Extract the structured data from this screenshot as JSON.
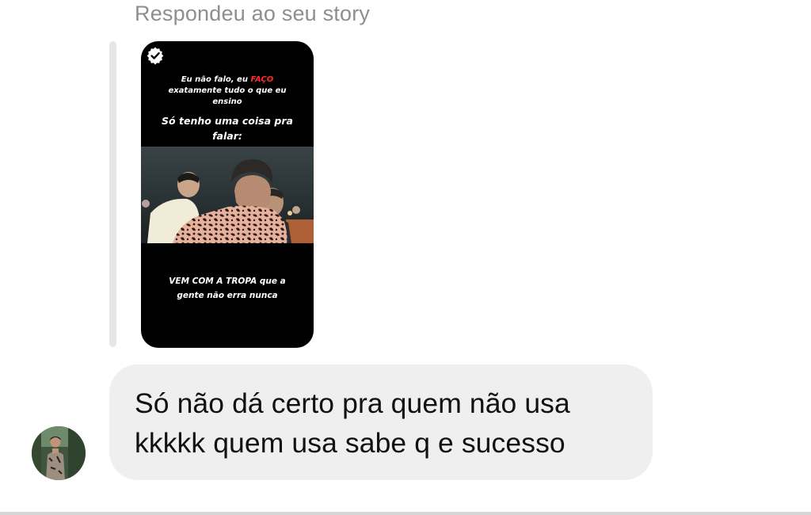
{
  "reply_context": "Respondeu ao seu story",
  "story": {
    "line1_a": "Eu não falo, eu ",
    "line1_highlight": "FAÇO",
    "line1_b": " exatamente tudo o que eu ensino",
    "line2": "Só tenho uma coisa pra falar:",
    "line3": "VEM COM A TROPA que a gente não erra nunca",
    "highlight_color": "#ff2b2b"
  },
  "message": {
    "text": "Só não dá certo pra quem não usa kkkkk quem usa sabe q e sucesso"
  },
  "icons": {
    "story_badge": "verified-story-icon",
    "avatar": "user-avatar"
  },
  "colors": {
    "bubble_background": "#efefef",
    "reply_context_text": "#8e8e8e",
    "story_background": "#000000"
  }
}
